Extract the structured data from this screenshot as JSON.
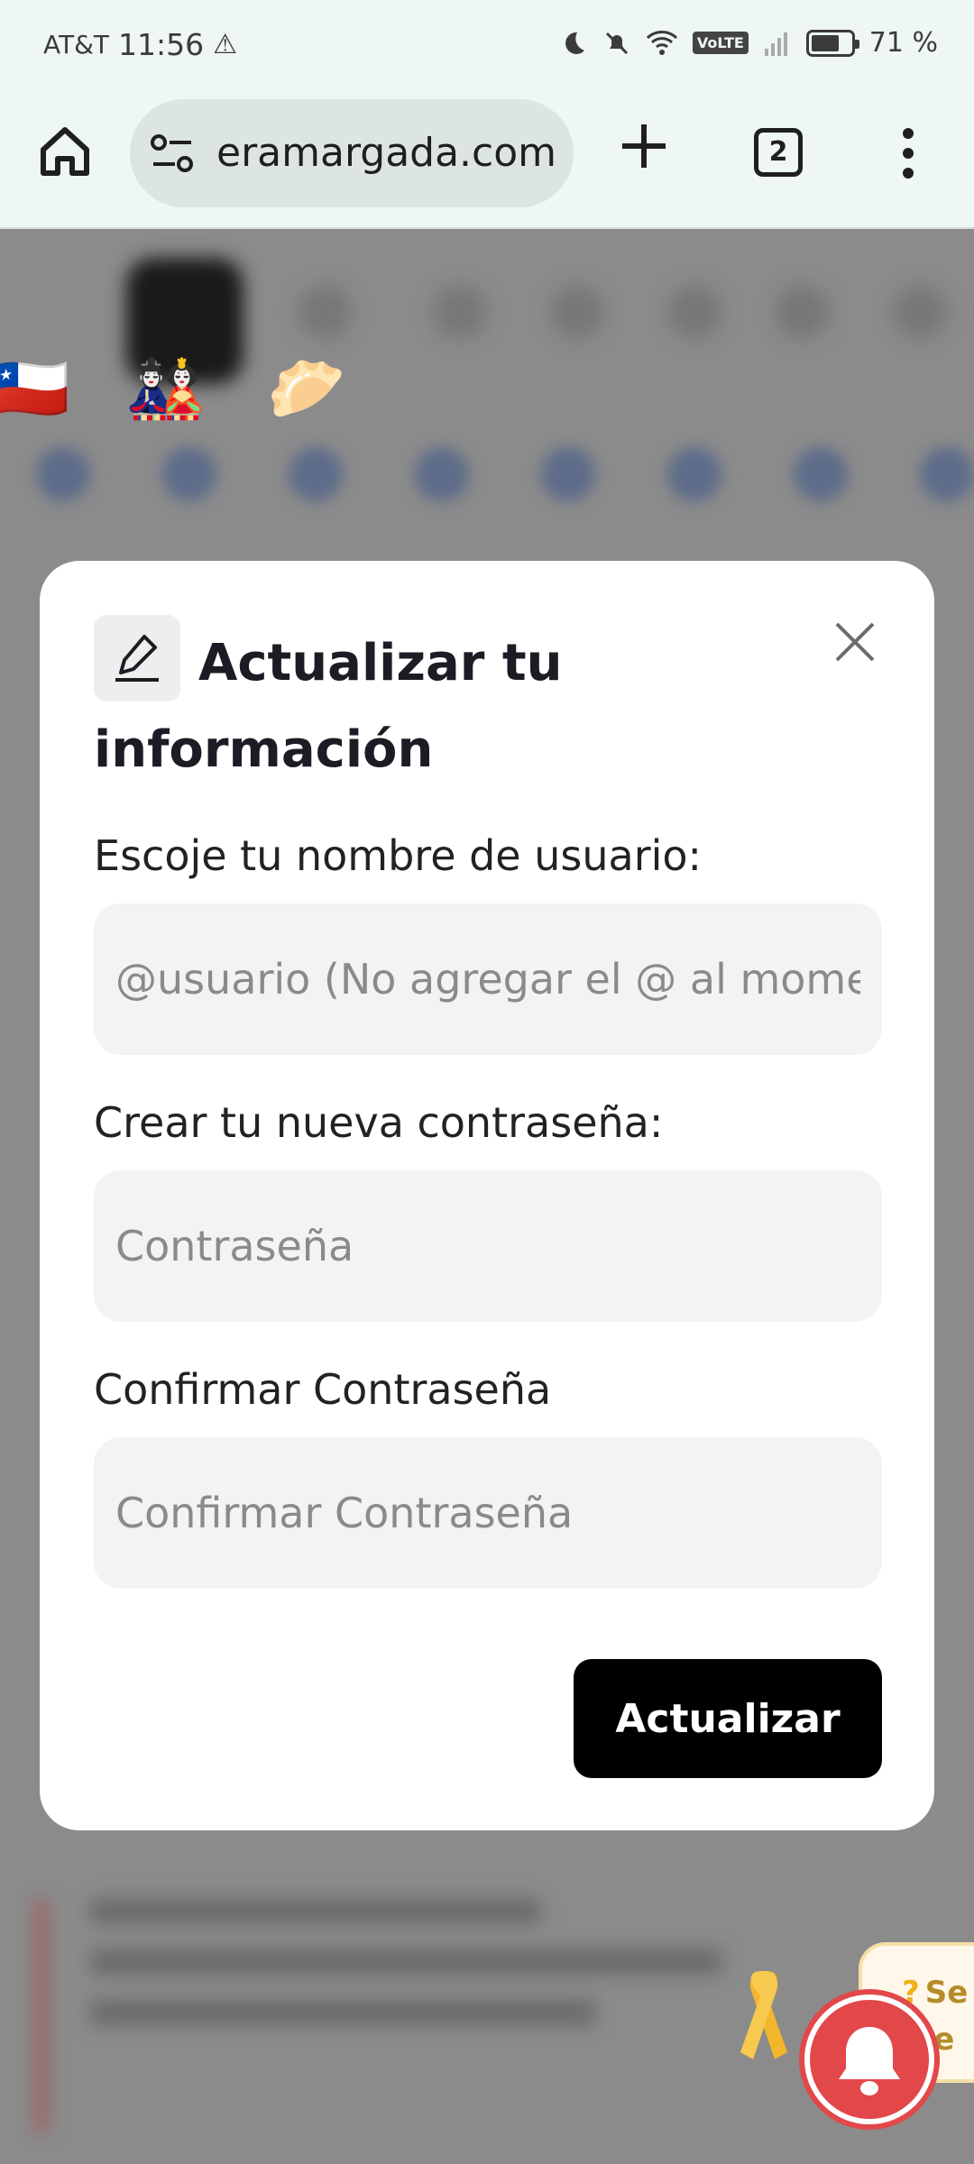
{
  "status_bar": {
    "carrier": "AT&T",
    "time": "11:56",
    "warning_icon": "⚠",
    "network_badge": "VoLTE",
    "battery_text": "71 %",
    "battery_level": 0.71
  },
  "browser": {
    "url_text": "eramargada.com",
    "tab_count": "2",
    "icons": [
      "home-icon",
      "site-settings-icon",
      "new-tab-icon",
      "tab-switcher-icon",
      "menu-icon"
    ]
  },
  "background": {
    "emojis": [
      "🇨🇱",
      "🎎",
      "🥟"
    ]
  },
  "modal": {
    "title": "Actualizar tu información",
    "username_label": "Escoje tu nombre de usuario:",
    "username_placeholder": "@usuario (No agregar el @ al momento de escribir)",
    "password_label": "Crear tu nueva contraseña:",
    "password_placeholder": "Contraseña",
    "confirm_label": "Confirmar Contraseña",
    "confirm_placeholder": "Confirmar Contraseña",
    "submit_label": "Actualizar"
  },
  "floating": {
    "help_q": "?",
    "help_text_1": "Se",
    "help_text_2": "o e"
  },
  "colors": {
    "toolbar_bg": "#eef7f5",
    "overlay_bg": "#8b8b8b",
    "button_bg": "#000000",
    "bell_red": "#e2474a"
  }
}
